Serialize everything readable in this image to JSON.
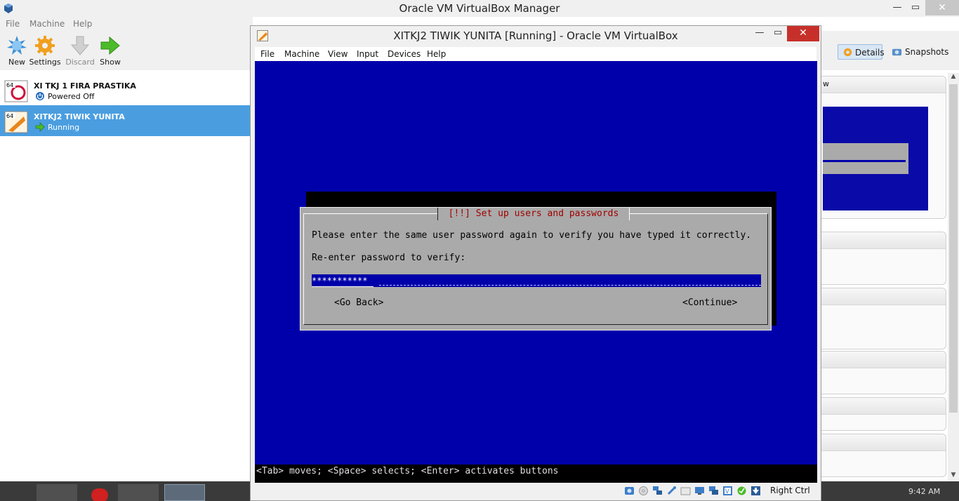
{
  "manager": {
    "title": "Oracle VM VirtualBox Manager",
    "menu": [
      "File",
      "Machine",
      "Help"
    ],
    "toolbar": [
      {
        "label": "New",
        "icon": "new-starburst-icon"
      },
      {
        "label": "Settings",
        "icon": "gear-icon"
      },
      {
        "label": "Discard",
        "icon": "down-arrow-icon"
      },
      {
        "label": "Show",
        "icon": "right-arrow-icon"
      }
    ],
    "views": {
      "details": "Details",
      "snapshots": "Snapshots"
    },
    "window_controls": {
      "minimize": "—",
      "maximize": "▭",
      "close": "✕"
    },
    "preview_header_fragment": "w",
    "vms": [
      {
        "name": "XI TKJ 1 FIRA PRASTIKA",
        "state": "Powered Off",
        "os_badge": "64",
        "selected": false
      },
      {
        "name": "XITKJ2 TIWIK YUNITA",
        "state": "Running",
        "os_badge": "64",
        "selected": true
      }
    ],
    "clock": "9:42 AM"
  },
  "vm_window": {
    "title": "XITKJ2 TIWIK YUNITA [Running] - Oracle VM VirtualBox",
    "window_controls": {
      "minimize": "—",
      "maximize": "▭",
      "close": "✕"
    },
    "menu": [
      "File",
      "Machine",
      "View",
      "Input",
      "Devices",
      "Help"
    ],
    "guest": {
      "dialog_title": "[!!] Set up users and passwords",
      "message": "Please enter the same user password again to verify you have typed it correctly.",
      "field_label": "Re-enter password to verify:",
      "password_value": "***********",
      "go_back": "<Go Back>",
      "continue": "<Continue>",
      "status_line": "<Tab> moves; <Space> selects; <Enter> activates buttons"
    },
    "statusbar": {
      "icons": [
        "hard-disk-icon",
        "optical-drive-icon",
        "network-icon",
        "usb-icon",
        "shared-folder-icon",
        "display-icon",
        "video-capture-icon",
        "cpu-icon",
        "guest-additions-icon",
        "mouse-integration-icon"
      ],
      "host_key": "Right Ctrl"
    }
  },
  "colors": {
    "guest_blue": "#0000aa",
    "dialog_gray": "#aaaaaa",
    "dialog_title_red": "#a00000",
    "selection_blue": "#4a9ee0",
    "close_red": "#c7302a"
  }
}
